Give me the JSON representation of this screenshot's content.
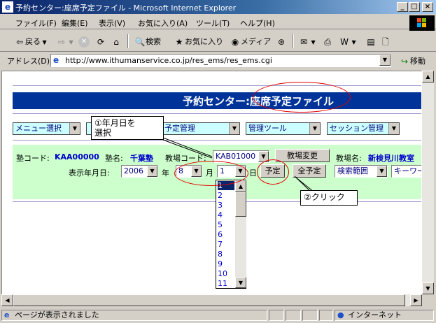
{
  "window": {
    "title": "予約センター:座席予定ファイル - Microsoft Internet Explorer",
    "minimize": "_",
    "maximize": "□",
    "close": "×"
  },
  "menu": [
    "ファイル(F)",
    "編集(E)",
    "表示(V)",
    "お気に入り(A)",
    "ツール(T)",
    "ヘルプ(H)"
  ],
  "toolbar": {
    "back": "戻る",
    "search": "検索",
    "favorites": "お気に入り",
    "media": "メディア"
  },
  "address": {
    "label": "アドレス(D)",
    "url": "http://www.ithumanservice.co.jp/res_ems/res_ems.cgi",
    "go": "移動"
  },
  "page": {
    "header": "予約センター:座席予定ファイル",
    "nav": [
      "メニュー選択",
      "予定管理",
      "管理ツール",
      "セッション管理"
    ],
    "juku_code_label": "塾コード:",
    "juku_code": "KAA00000",
    "juku_name_label": "塾名:",
    "juku_name": "千葉塾",
    "classroom_code_label": "教場コード:",
    "classroom_code": "KAB01000",
    "classroom_change": "教場変更",
    "classroom_name_label": "教場名:",
    "classroom_name": "新検見川教室",
    "date_label": "表示年月日:",
    "year": "2006",
    "year_unit": "年",
    "month": "8",
    "month_unit": "月",
    "day": "1",
    "day_unit": "日",
    "schedule_btn": "予定",
    "all_schedule_btn": "全予定",
    "search_range": "検索範囲",
    "keyword": "キーワー"
  },
  "day_options": [
    "1",
    "2",
    "3",
    "4",
    "5",
    "6",
    "7",
    "8",
    "9",
    "10",
    "11"
  ],
  "annotations": {
    "step1": [
      "①年月日を",
      "選択"
    ],
    "step2": "②クリック"
  },
  "status": {
    "message": "ページが表示されました",
    "zone": "インターネット"
  },
  "colors": {
    "header_bg": "#003399",
    "form_bg": "#ccffcc",
    "nav_bg": "#ccffff",
    "annotation": "#e60000"
  }
}
